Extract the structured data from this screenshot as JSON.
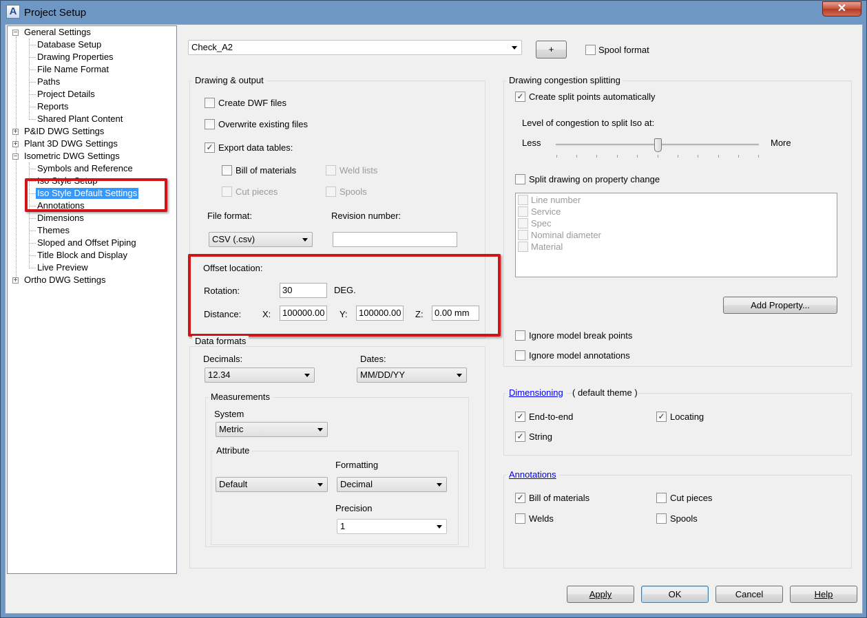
{
  "window": {
    "title": "Project Setup",
    "close_label": "✕"
  },
  "tree": {
    "items": [
      "General Settings",
      "Database Setup",
      "Drawing Properties",
      "File Name Format",
      "Paths",
      "Project Details",
      "Reports",
      "Shared Plant Content",
      "P&ID DWG Settings",
      "Plant 3D DWG Settings",
      "Isometric DWG Settings",
      "Symbols and Reference",
      "Iso Style Setup",
      "Iso Style Default Settings",
      "Annotations",
      "Dimensions",
      "Themes",
      "Sloped and Offset Piping",
      "Title Block and Display",
      "Live Preview",
      "Ortho DWG Settings"
    ],
    "expand_minus": "−",
    "expand_plus": "+"
  },
  "style_combo": {
    "value": "Check_A2"
  },
  "plus_button": "+",
  "spool_format": {
    "label": "Spool format",
    "checked": false
  },
  "drawing_output": {
    "title": "Drawing & output",
    "create_dwf": "Create DWF files",
    "overwrite": "Overwrite existing files",
    "export_tables": "Export data tables:",
    "bill_of_materials": "Bill of materials",
    "weld_lists": "Weld lists",
    "cut_pieces": "Cut pieces",
    "spools": "Spools",
    "file_format_label": "File format:",
    "file_format_value": "CSV (.csv)",
    "revision_label": "Revision number:",
    "revision_value": ""
  },
  "offset": {
    "title": "Offset location:",
    "rotation_label": "Rotation:",
    "rotation_value": "30",
    "rotation_unit": "DEG.",
    "distance_label": "Distance:",
    "x_label": "X:",
    "x_value": "100000.00",
    "y_label": "Y:",
    "y_value": "100000.00",
    "z_label": "Z:",
    "z_value": "0.00 mm"
  },
  "data_formats": {
    "title": "Data formats",
    "decimals_label": "Decimals:",
    "decimals_value": "12.34",
    "dates_label": "Dates:",
    "dates_value": "MM/DD/YY",
    "measurements_title": "Measurements",
    "system_label": "System",
    "system_value": "Metric",
    "attribute_title": "Attribute",
    "attribute_value": "Default",
    "formatting_label": "Formatting",
    "formatting_value": "Decimal",
    "precision_label": "Precision",
    "precision_value": "1"
  },
  "congestion": {
    "title": "Drawing congestion splitting",
    "create_split": "Create split points automatically",
    "level_label": "Level of congestion to split Iso at:",
    "less": "Less",
    "more": "More",
    "level_value": 0.5,
    "split_property": "Split drawing on property change",
    "properties": [
      "Line number",
      "Service",
      "Spec",
      "Nominal diameter",
      "Material"
    ],
    "add_property": "Add Property...",
    "ignore_break": "Ignore model break points",
    "ignore_annotations": "Ignore model annotations"
  },
  "dimensioning": {
    "link": "Dimensioning",
    "theme": "( default theme )",
    "end_to_end": "End-to-end",
    "locating": "Locating",
    "string": "String"
  },
  "annotations": {
    "link": "Annotations",
    "bill_of_materials": "Bill of materials",
    "cut_pieces": "Cut pieces",
    "welds": "Welds",
    "spools": "Spools"
  },
  "buttons": {
    "apply": "Apply",
    "ok": "OK",
    "cancel": "Cancel",
    "help": "Help"
  },
  "check_glyph": "✓"
}
